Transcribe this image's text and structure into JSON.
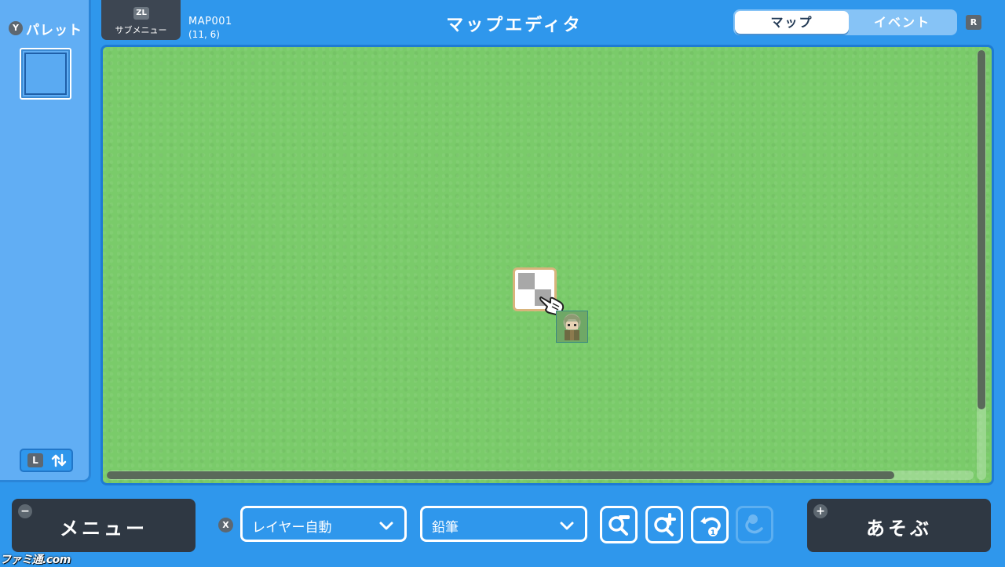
{
  "palette": {
    "button_badge": "Y",
    "title": "パレット",
    "switch_badge": "L",
    "swap_icon": "swap-vertical-icon"
  },
  "header": {
    "submenu_badge": "ZL",
    "submenu_label": "サブメニュー",
    "map_id": "MAP001",
    "cursor_coord": "(11, 6)",
    "title": "マップエディタ",
    "tabs": [
      {
        "label": "マップ",
        "active": true
      },
      {
        "label": "イベント",
        "active": false
      }
    ],
    "tab_switch_badge": "R"
  },
  "map": {
    "ground_color": "#7acb6a"
  },
  "footer": {
    "menu_badge": "−",
    "menu_label": "メニュー",
    "layer_badge": "X",
    "layer_value": "レイヤー自動",
    "tool_value": "鉛筆",
    "tool_icons": [
      "zoom-out-icon",
      "zoom-in-icon",
      "undo-icon",
      "redo-icon"
    ],
    "play_badge": "+",
    "play_label": "あそぶ"
  },
  "watermark": "ファミ通.com",
  "colors": {
    "background": "#2f97ec",
    "dark_button": "#2f3843",
    "grass": "#7acb6a"
  }
}
